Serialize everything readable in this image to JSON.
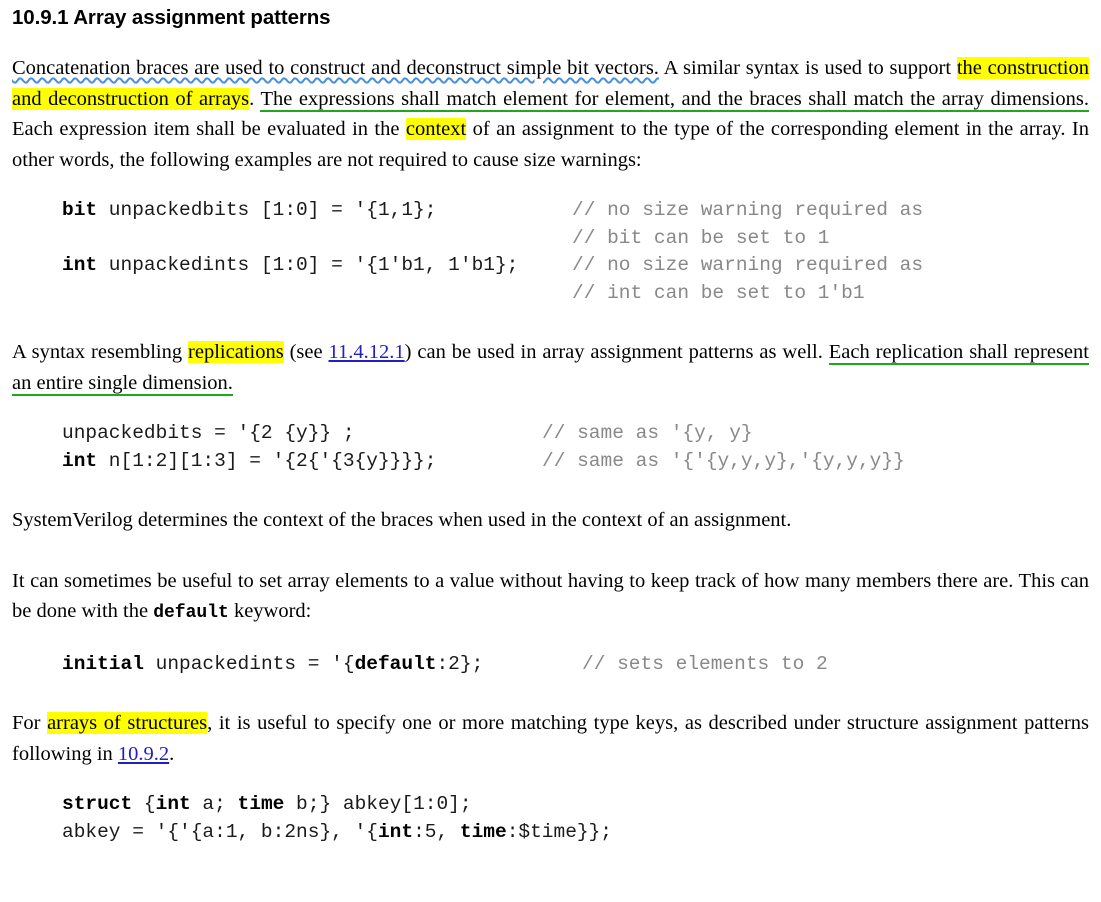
{
  "document": {
    "section_number": "10.9.1",
    "heading": "10.9.1 Array assignment patterns",
    "paragraph1": {
      "seg_squiggly": "Concatenation braces are used to construct and deconstruct simple bit vectors.",
      "seg_plain1": " A similar syntax is used to support ",
      "seg_highlight1": "the construction and deconstruction of arrays",
      "seg_plain2": ". ",
      "seg_green_underline": "The expressions shall match element for element, and the braces shall match the array dimensions.",
      "seg_plain3": " Each expression item shall be evaluated in the ",
      "seg_highlight2": "context",
      "seg_plain4": " of an assignment to the type of the corresponding element in the array. In other words, the following examples are not required to cause size warnings:"
    },
    "paragraph2": {
      "seg_plain1": "A syntax resembling ",
      "seg_highlight": "replications",
      "seg_plain2": " (see ",
      "link_text": "11.4.12.1",
      "seg_plain3": ") can be used in array assignment patterns as well. ",
      "seg_green_underline": "Each replication shall represent an entire single dimension."
    },
    "paragraph3": "SystemVerilog determines the context of the braces when used in the context of an assignment.",
    "paragraph4": {
      "seg_plain1": "It can sometimes be useful to set array elements to a value without having to keep track of how many members there are. This can be done with the ",
      "keyword": "default",
      "seg_plain2": " keyword:"
    },
    "paragraph5": {
      "seg_plain1": "For ",
      "seg_highlight": "arrays of structures",
      "seg_plain2": ", it is useful to specify one or more matching type keys, as described under structure assignment patterns following in ",
      "link_text": "10.9.2",
      "seg_plain3": "."
    },
    "code_block_1": {
      "line1_kw": "bit",
      "line1_rest": " unpackedbits [1:0] = '{1,1};",
      "line1_comment": "// no size warning required as",
      "line2_comment": "// bit can be set to 1",
      "line3_kw": "int",
      "line3_rest": " unpackedints [1:0] = '{1'b1, 1'b1};",
      "line3_comment": "// no size warning required as",
      "line4_comment": "// int can be set to 1'b1"
    },
    "code_block_2": {
      "line1_code": "unpackedbits = '{2 {y}} ;",
      "line1_comment": "// same as '{y, y}",
      "line2_kw": "int",
      "line2_rest": " n[1:2][1:3] = '{2{'{3{y}}}};",
      "line2_comment": "// same as '{'{y,y,y},'{y,y,y}}"
    },
    "code_block_3": {
      "kw1": "initial",
      "mid1": " unpackedints = '{",
      "kw2": "default",
      "mid2": ":2};",
      "comment": "// sets elements to 2"
    },
    "code_block_4": {
      "l1_kw1": "struct",
      "l1_mid1": " {",
      "l1_kw2": "int",
      "l1_mid2": " a; ",
      "l1_kw3": "time",
      "l1_mid3": " b;} abkey[1:0];",
      "l2_pre": "abkey = '{'{a:1, b:2ns}, '{",
      "l2_kw1": "int",
      "l2_mid1": ":5, ",
      "l2_kw2": "time",
      "l2_mid2": ":$time}};"
    }
  },
  "colors": {
    "highlight_yellow": "#ffff00",
    "underline_green": "#1fa81f",
    "squiggly_blue": "#4b90d6",
    "link_blue": "#2020c0",
    "comment_gray": "#888888",
    "text_black": "#000000"
  }
}
